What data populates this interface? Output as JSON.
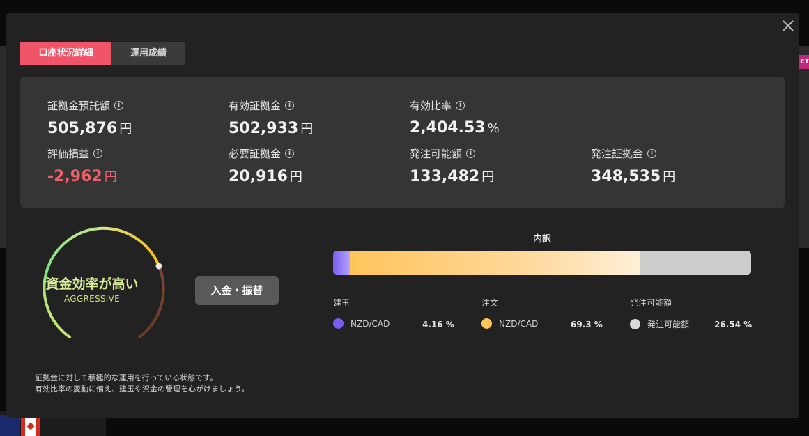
{
  "tabs": {
    "details": "口座状況詳細",
    "performance": "運用成績"
  },
  "background": {
    "badge": "ET"
  },
  "metrics": [
    {
      "label": "証拠金預託額",
      "value": "505,876",
      "unit": "円",
      "negative": false
    },
    {
      "label": "有効証拠金",
      "value": "502,933",
      "unit": "円",
      "negative": false
    },
    {
      "label": "有効比率",
      "value": "2,404.53",
      "unit": "%",
      "negative": false
    },
    {
      "label": "評価損益",
      "value": "-2,962",
      "unit": "円",
      "negative": true
    },
    {
      "label": "必要証拠金",
      "value": "20,916",
      "unit": "円",
      "negative": false
    },
    {
      "label": "発注可能額",
      "value": "133,482",
      "unit": "円",
      "negative": false
    },
    {
      "label": "発注証拠金",
      "value": "348,535",
      "unit": "円",
      "negative": false
    }
  ],
  "gauge": {
    "title": "資金効率が高い",
    "subtitle": "AGGRESSIVE"
  },
  "deposit_button": "入金・振替",
  "description": {
    "line1": "証拠金に対して積極的な運用を行っている状態です。",
    "line2": "有効比率の変動に備え、建玉や資金の管理を心がけましょう。"
  },
  "breakdown": {
    "title": "内訳",
    "groups": [
      {
        "title": "建玉",
        "item": "NZD/CAD",
        "percent": 4.16,
        "percent_label": "4.16 %",
        "color": "#7b5cf0"
      },
      {
        "title": "注文",
        "item": "NZD/CAD",
        "percent": 69.3,
        "percent_label": "69.3 %",
        "color": "#ffc55c"
      },
      {
        "title": "発注可能額",
        "item": "発注可能額",
        "percent": 26.54,
        "percent_label": "26.54 %",
        "color": "#d9d9d9"
      }
    ]
  }
}
